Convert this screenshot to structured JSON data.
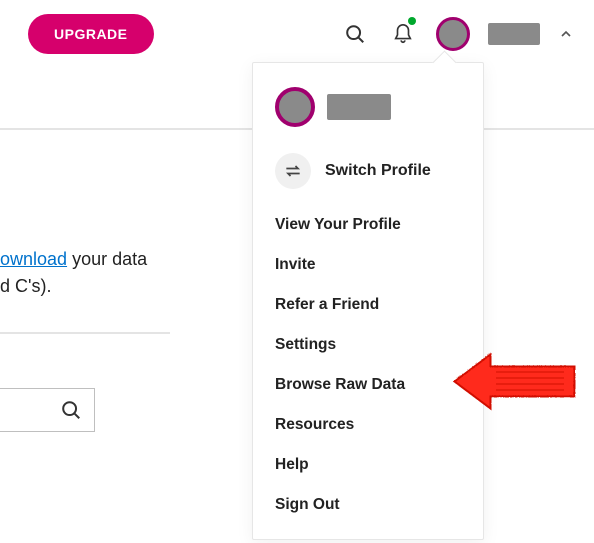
{
  "topbar": {
    "upgrade_label": "UPGRADE"
  },
  "left_text": {
    "link": "ownload",
    "mid": " your data",
    "line2": "d C's)."
  },
  "dropdown": {
    "switch_label": "Switch Profile",
    "items": [
      "View Your Profile",
      "Invite",
      "Refer a Friend",
      "Settings",
      "Browse Raw Data",
      "Resources",
      "Help",
      "Sign Out"
    ]
  }
}
